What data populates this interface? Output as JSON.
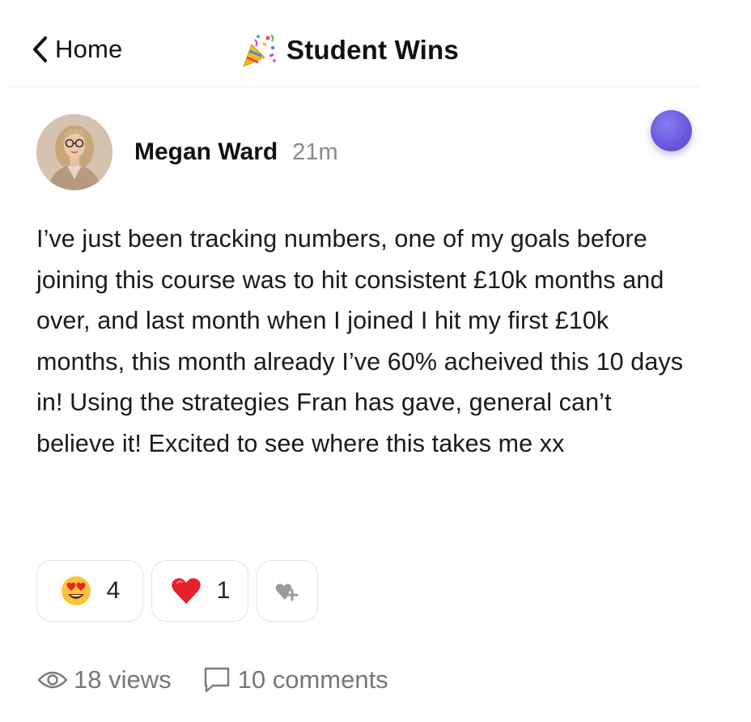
{
  "header": {
    "back_label": "Home",
    "title": "Student Wins",
    "title_icon": "party-popper-icon",
    "back_icon": "chevron-left-icon"
  },
  "post": {
    "author": "Megan Ward",
    "time": "21m",
    "body": "I’ve just been tracking numbers, one of my goals before joining this course was to hit consistent £10k months and over, and last month when I joined I hit my first £10k months, this month already I’ve 60% acheived this 10 days in! Using the strategies Fran has gave, general can’t believe it! Excited to see where this takes me xx",
    "status_color": "#6a5ae0"
  },
  "reactions": [
    {
      "icon": "heart-eyes-emoji-icon",
      "count": "4"
    },
    {
      "icon": "red-heart-emoji-icon",
      "count": "1"
    },
    {
      "icon": "add-reaction-icon"
    }
  ],
  "stats": {
    "views": "18 views",
    "comments": "10 comments"
  }
}
